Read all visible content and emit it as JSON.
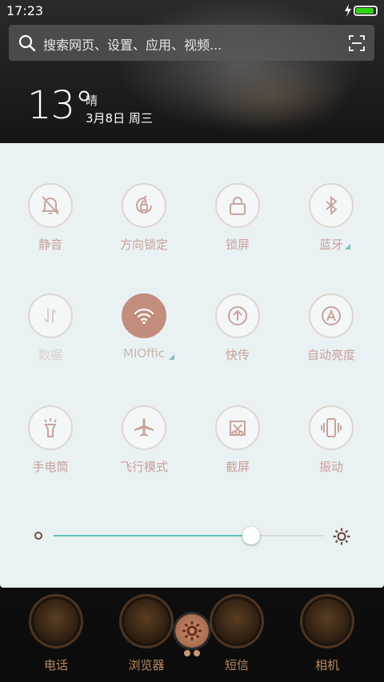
{
  "status_bar": {
    "time": "17:23",
    "battery_level": 1.0,
    "charging": true,
    "battery_color": "#35d21a"
  },
  "search": {
    "placeholder": "搜索网页、设置、应用、视频..."
  },
  "weather": {
    "temperature": "13°",
    "condition": "晴",
    "date": "3月8日 周三"
  },
  "quick_settings": [
    {
      "label": "静音",
      "icon": "bell-off-icon",
      "active": false
    },
    {
      "label": "方向锁定",
      "icon": "rotation-lock-icon",
      "active": false
    },
    {
      "label": "锁屏",
      "icon": "lock-icon",
      "active": false
    },
    {
      "label": "蓝牙",
      "icon": "bluetooth-icon",
      "active": false,
      "expandable": true
    },
    {
      "label": "数据",
      "icon": "mobile-data-icon",
      "active": false,
      "disabled": true
    },
    {
      "label": "MIOffic",
      "icon": "wifi-icon",
      "active": true,
      "expandable": true
    },
    {
      "label": "快传",
      "icon": "upload-share-icon",
      "active": false
    },
    {
      "label": "自动亮度",
      "icon": "auto-brightness-icon",
      "active": false
    },
    {
      "label": "手电筒",
      "icon": "flashlight-icon",
      "active": false
    },
    {
      "label": "飞行模式",
      "icon": "airplane-icon",
      "active": false
    },
    {
      "label": "截屏",
      "icon": "screenshot-scissors-icon",
      "active": false
    },
    {
      "label": "振动",
      "icon": "vibrate-icon",
      "active": false
    }
  ],
  "brightness": {
    "level": 0.73
  },
  "colors": {
    "accent": "#63c1bf",
    "tile_active": "#c28d7d",
    "label": "#caa09a",
    "panel_bg": "#e9f1f3"
  },
  "dock": [
    {
      "label": "电话",
      "icon": "phone-app-icon"
    },
    {
      "label": "浏览器",
      "icon": "browser-app-icon"
    },
    {
      "label": "短信",
      "icon": "messages-app-icon"
    },
    {
      "label": "相机",
      "icon": "camera-app-icon"
    }
  ]
}
